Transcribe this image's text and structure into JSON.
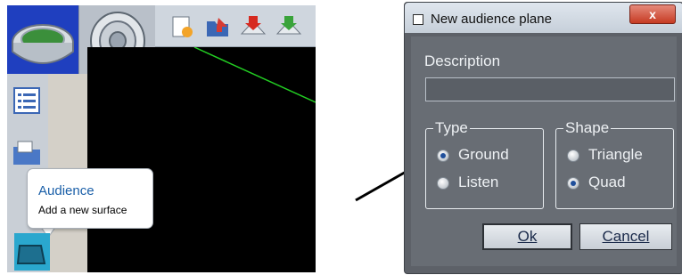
{
  "tooltip": {
    "title": "Audience",
    "description": "Add a new surface"
  },
  "dialog": {
    "title": "New audience plane",
    "close_label": "x",
    "description_label": "Description",
    "description_value": "",
    "type_group": {
      "title": "Type",
      "options": [
        {
          "label": "Ground",
          "checked": true
        },
        {
          "label": "Listen",
          "checked": false
        }
      ]
    },
    "shape_group": {
      "title": "Shape",
      "options": [
        {
          "label": "Triangle",
          "checked": false
        },
        {
          "label": "Quad",
          "checked": true
        }
      ]
    },
    "ok_label": "Ok",
    "cancel_label": "Cancel"
  },
  "icons": {
    "app_logo": "stadium-icon",
    "speaker": "speaker-icon",
    "toolbar": [
      "new-file-icon",
      "open-folder-icon",
      "import-icon",
      "export-icon"
    ],
    "leftbar": [
      "list-icon",
      "folder-icon",
      "audience-surface-icon"
    ]
  },
  "colors": {
    "canvas_bg": "#000000",
    "canvas_line": "#22cc22",
    "tooltip_title": "#1a5fa8",
    "dialog_bg": "#686d74"
  }
}
